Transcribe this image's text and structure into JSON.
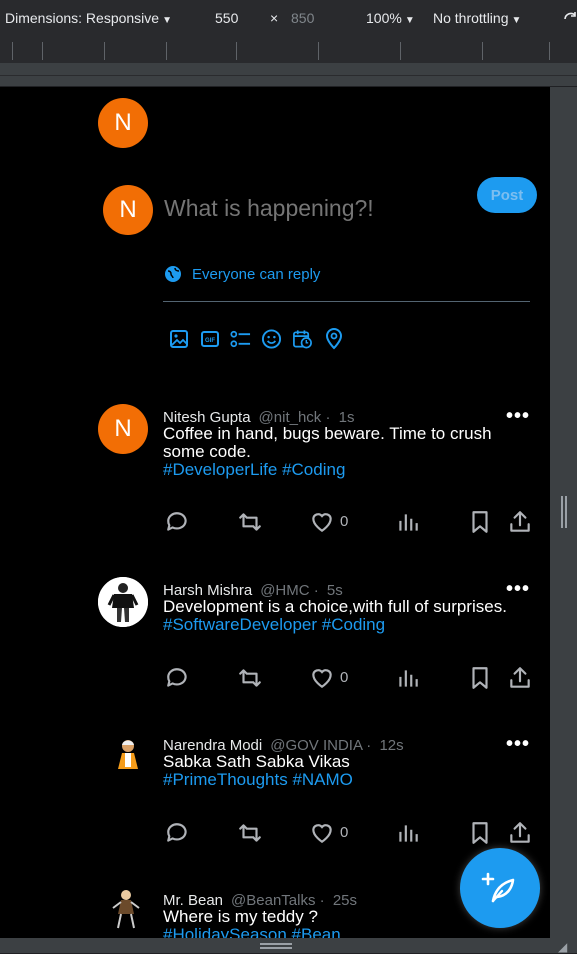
{
  "devtools": {
    "dimensions_label": "Dimensions: Responsive",
    "width": "550",
    "times": "×",
    "height": "850",
    "zoom": "100%",
    "throttling": "No throttling"
  },
  "composer": {
    "top_avatar_letter": "N",
    "avatar_letter": "N",
    "placeholder": "What is happening?!",
    "post_label": "Post",
    "reply_setting": "Everyone can reply",
    "tools": [
      "image-icon",
      "gif-icon",
      "poll-icon",
      "emoji-icon",
      "schedule-icon",
      "location-icon"
    ]
  },
  "tweets": [
    {
      "avatar_letter": "N",
      "name": "Nitesh Gupta",
      "handle": "@nit_hck ·",
      "time": "1s",
      "text": "Coffee in hand, bugs beware. Time to crush some code.",
      "tags": "#DeveloperLife #Coding",
      "likes": "0"
    },
    {
      "name": "Harsh Mishra",
      "handle": "@HMC ·",
      "time": "5s",
      "text": "Development is a choice,with full of surprises.",
      "tags": "#SoftwareDeveloper #Coding",
      "likes": "0"
    },
    {
      "name": "Narendra Modi",
      "handle": "@GOV INDIA ·",
      "time": "12s",
      "text": "Sabka Sath Sabka Vikas",
      "tags": "#PrimeThoughts #NAMO",
      "likes": "0"
    },
    {
      "name": "Mr. Bean",
      "handle": "@BeanTalks ·",
      "time": "25s",
      "text": "Where is my teddy ?",
      "tags": "#HolidaySeason #Bean"
    }
  ],
  "colors": {
    "accent": "#1d9bf0",
    "avatar_orange": "#f26e05",
    "background": "#000000"
  }
}
